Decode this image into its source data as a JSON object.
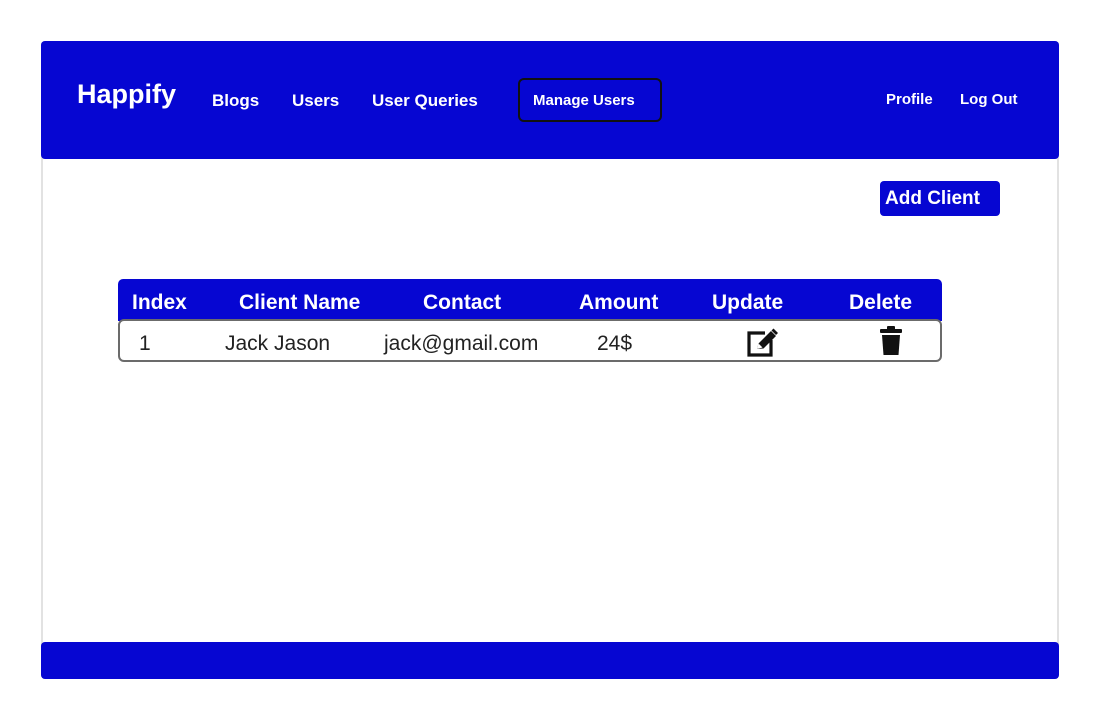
{
  "header": {
    "brand": "Happify",
    "nav": {
      "blogs": "Blogs",
      "users": "Users",
      "user_queries": "User Queries",
      "manage_users": "Manage Users"
    },
    "right": {
      "profile": "Profile",
      "logout": "Log Out"
    }
  },
  "actions": {
    "add_client": "Add Client"
  },
  "table": {
    "columns": [
      "Index",
      "Client Name",
      "Contact",
      "Amount",
      "Update",
      "Delete"
    ],
    "rows": [
      {
        "index": "1",
        "client_name": "Jack Jason",
        "contact": "jack@gmail.com",
        "amount": "24$",
        "update_icon": "edit-icon",
        "delete_icon": "trash-icon"
      }
    ]
  },
  "colors": {
    "primary": "#0606d2",
    "text": "#222222",
    "row_border": "#6b6b6b"
  }
}
